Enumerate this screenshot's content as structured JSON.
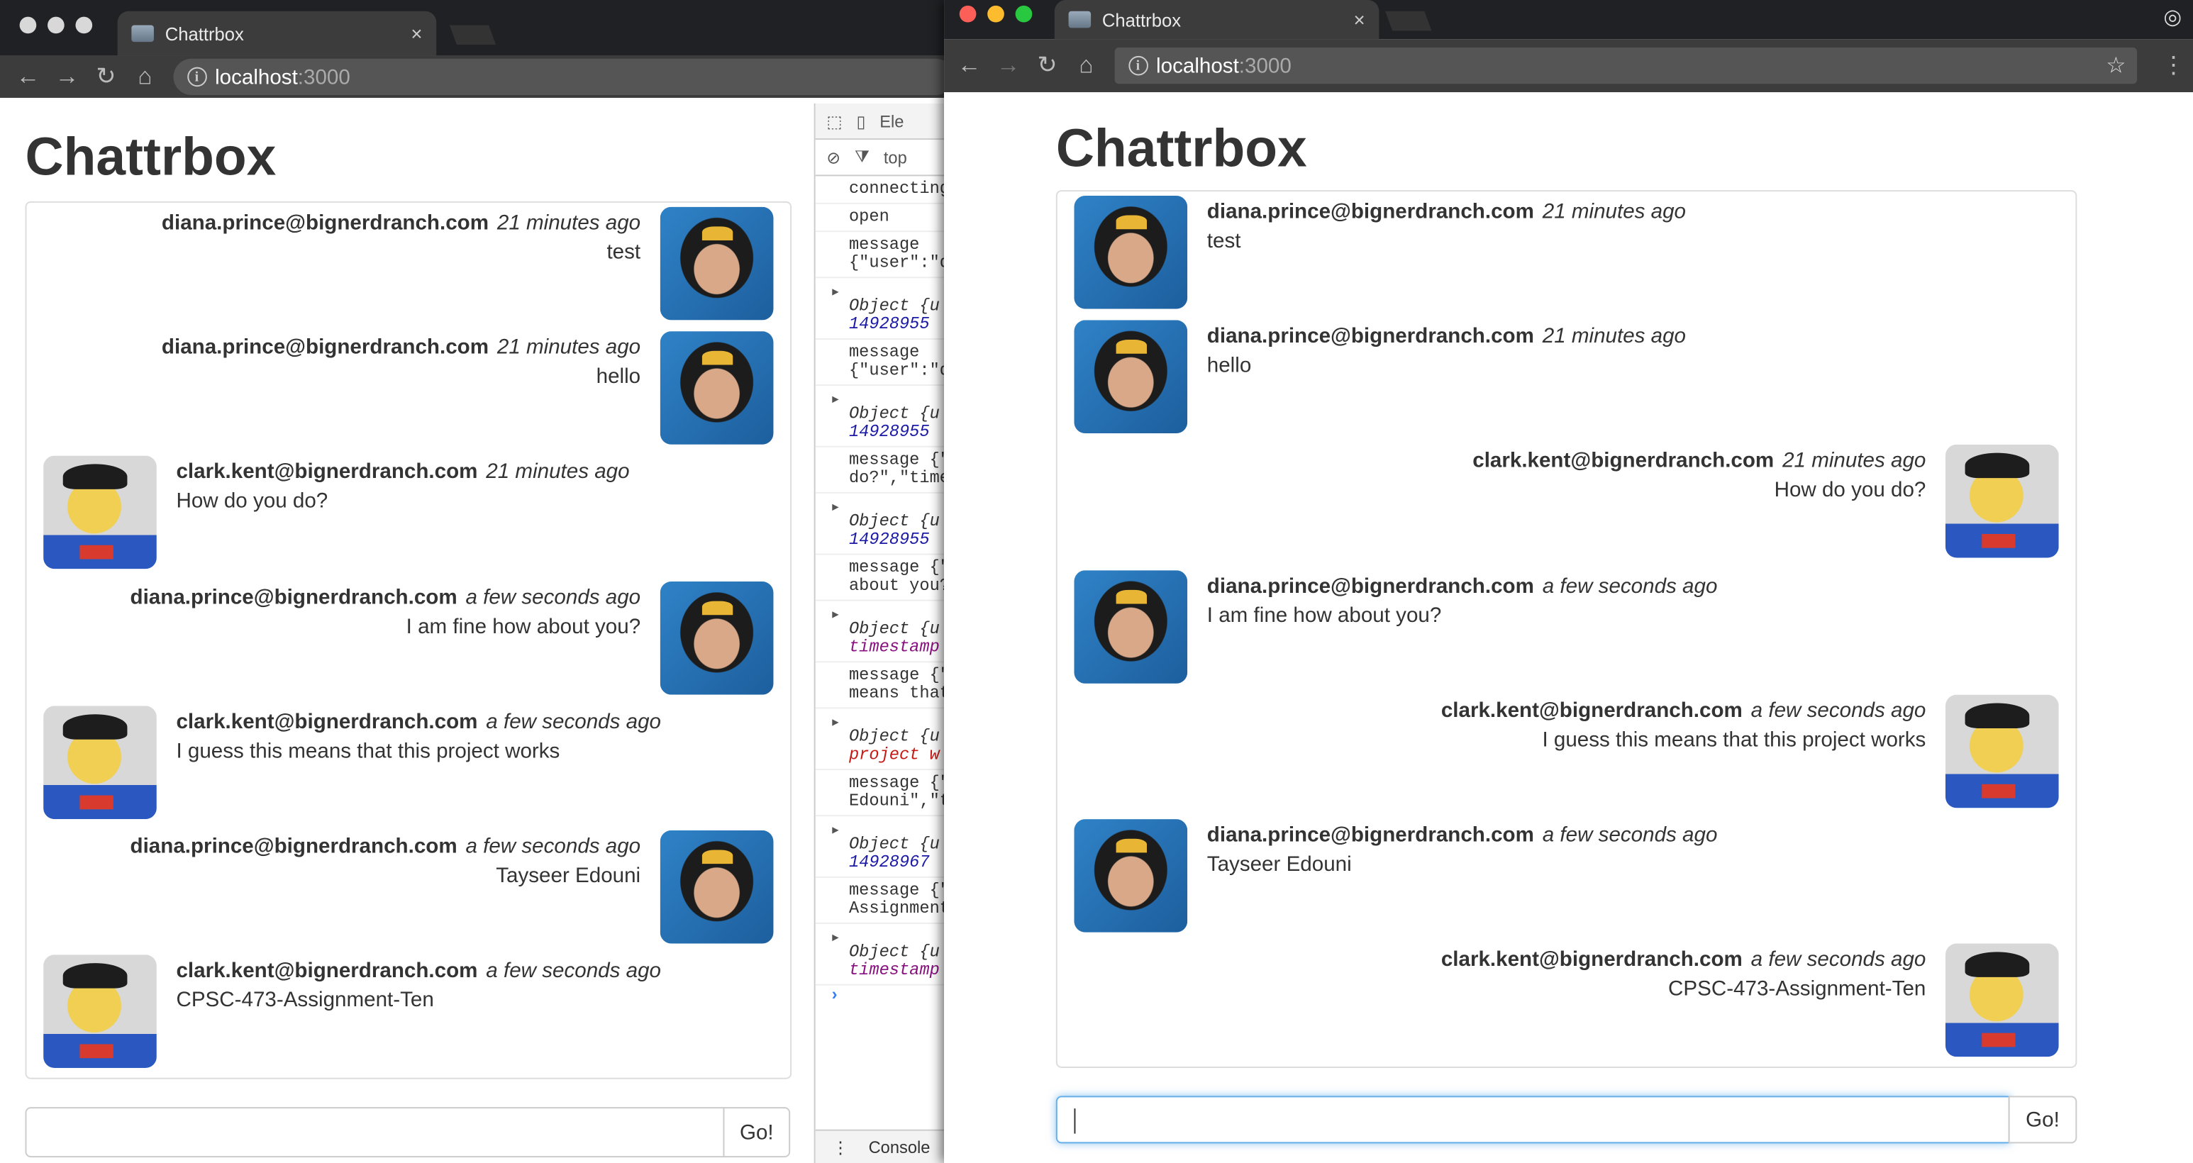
{
  "left_window": {
    "tab_title": "Chattrbox",
    "url_host": "localhost",
    "url_port": ":3000",
    "heading": "Chattrbox",
    "send_label": "Go!",
    "messages": [
      {
        "user": "diana.prince@bignerdranch.com",
        "time": "21 minutes ago",
        "text": "test",
        "avatar": "diana"
      },
      {
        "user": "diana.prince@bignerdranch.com",
        "time": "21 minutes ago",
        "text": "hello",
        "avatar": "diana"
      },
      {
        "user": "clark.kent@bignerdranch.com",
        "time": "21 minutes ago",
        "text": "How do you do?",
        "avatar": "clark"
      },
      {
        "user": "diana.prince@bignerdranch.com",
        "time": "a few seconds ago",
        "text": "I am fine how about you?",
        "avatar": "diana"
      },
      {
        "user": "clark.kent@bignerdranch.com",
        "time": "a few seconds ago",
        "text": "I guess this means that this project works",
        "avatar": "clark"
      },
      {
        "user": "diana.prince@bignerdranch.com",
        "time": "a few seconds ago",
        "text": "Tayseer Edouni",
        "avatar": "diana"
      },
      {
        "user": "clark.kent@bignerdranch.com",
        "time": "a few seconds ago",
        "text": "CPSC-473-Assignment-Ten",
        "avatar": "clark"
      }
    ]
  },
  "right_window": {
    "tab_title": "Chattrbox",
    "url_host": "localhost",
    "url_port": ":3000",
    "heading": "Chattrbox",
    "send_label": "Go!",
    "input_value": "",
    "messages": [
      {
        "user": "diana.prince@bignerdranch.com",
        "time": "21 minutes ago",
        "text": "test",
        "avatar": "diana"
      },
      {
        "user": "diana.prince@bignerdranch.com",
        "time": "21 minutes ago",
        "text": "hello",
        "avatar": "diana"
      },
      {
        "user": "clark.kent@bignerdranch.com",
        "time": "21 minutes ago",
        "text": "How do you do?",
        "avatar": "clark"
      },
      {
        "user": "diana.prince@bignerdranch.com",
        "time": "a few seconds ago",
        "text": "I am fine how about you?",
        "avatar": "diana"
      },
      {
        "user": "clark.kent@bignerdranch.com",
        "time": "a few seconds ago",
        "text": "I guess this means that this project works",
        "avatar": "clark"
      },
      {
        "user": "diana.prince@bignerdranch.com",
        "time": "a few seconds ago",
        "text": "Tayseer Edouni",
        "avatar": "diana"
      },
      {
        "user": "clark.kent@bignerdranch.com",
        "time": "a few seconds ago",
        "text": "CPSC-473-Assignment-Ten",
        "avatar": "clark"
      }
    ]
  },
  "devtools": {
    "tab_label": "Ele",
    "context": "top",
    "console_tab": "Console",
    "lines": [
      {
        "kind": "text",
        "text": "connecting"
      },
      {
        "kind": "text",
        "text": "open"
      },
      {
        "kind": "text",
        "text": "message\n{\"user\":\"d"
      },
      {
        "kind": "obj",
        "text": "Object {u",
        "sub": "14928955",
        "subclass": "dt-num"
      },
      {
        "kind": "text",
        "text": "message\n{\"user\":\"d"
      },
      {
        "kind": "obj",
        "text": "Object {u",
        "sub": "14928955",
        "subclass": "dt-num"
      },
      {
        "kind": "text",
        "text": "message {\"\ndo?\",\"time"
      },
      {
        "kind": "obj",
        "text": "Object {u",
        "sub": "14928955",
        "subclass": "dt-num"
      },
      {
        "kind": "text",
        "text": "message {\"\nabout you?"
      },
      {
        "kind": "obj",
        "text": "Object {u",
        "sub": "timestamp",
        "subclass": "dt-key"
      },
      {
        "kind": "text",
        "text": "message {\"\nmeans that"
      },
      {
        "kind": "obj",
        "text": "Object {u",
        "sub": "project w",
        "subclass": "dt-red"
      },
      {
        "kind": "text",
        "text": "message {\"\nEdouni\",\"t"
      },
      {
        "kind": "obj",
        "text": "Object {u",
        "sub": "14928967",
        "subclass": "dt-num"
      },
      {
        "kind": "text",
        "text": "message {\"\nAssignment"
      },
      {
        "kind": "obj",
        "text": "Object {u",
        "sub": "timestamp",
        "subclass": "dt-key"
      }
    ],
    "prompt": "›"
  },
  "icons": {
    "back": "←",
    "forward": "→",
    "reload": "↻",
    "home": "⌂",
    "star": "☆",
    "menu": "⋮",
    "close": "×"
  },
  "colors": {
    "red_light": "#fc5f57",
    "yellow_light": "#fdbc2e",
    "green_light": "#28c840",
    "focus": "#66afe9"
  }
}
